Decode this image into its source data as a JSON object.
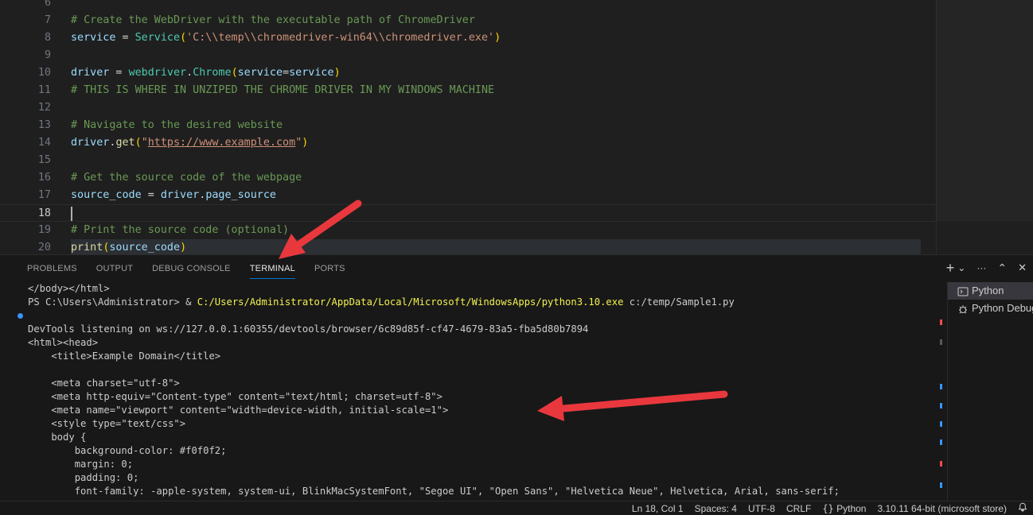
{
  "editor": {
    "lines": [
      {
        "n": "6",
        "tokens": []
      },
      {
        "n": "7",
        "tokens": [
          {
            "c": "c-comment",
            "t": "# Create the WebDriver with the executable path of ChromeDriver"
          }
        ]
      },
      {
        "n": "8",
        "tokens": [
          {
            "c": "c-var",
            "t": "service"
          },
          {
            "c": "c-punc",
            "t": " = "
          },
          {
            "c": "c-cls",
            "t": "Service"
          },
          {
            "c": "c-paren",
            "t": "("
          },
          {
            "c": "c-str",
            "t": "'C:\\\\temp\\\\chromedriver-win64\\\\chromedriver.exe'"
          },
          {
            "c": "c-paren",
            "t": ")"
          }
        ]
      },
      {
        "n": "9",
        "tokens": []
      },
      {
        "n": "10",
        "tokens": [
          {
            "c": "c-var",
            "t": "driver"
          },
          {
            "c": "c-punc",
            "t": " = "
          },
          {
            "c": "c-cls",
            "t": "webdriver"
          },
          {
            "c": "c-punc",
            "t": "."
          },
          {
            "c": "c-cls",
            "t": "Chrome"
          },
          {
            "c": "c-paren",
            "t": "("
          },
          {
            "c": "c-var",
            "t": "service"
          },
          {
            "c": "c-punc",
            "t": "="
          },
          {
            "c": "c-var",
            "t": "service"
          },
          {
            "c": "c-paren",
            "t": ")"
          }
        ]
      },
      {
        "n": "11",
        "tokens": [
          {
            "c": "c-comment",
            "t": "# THIS IS WHERE IN UNZIPED THE CHROME DRIVER IN MY WINDOWS MACHINE"
          }
        ]
      },
      {
        "n": "12",
        "tokens": []
      },
      {
        "n": "13",
        "tokens": [
          {
            "c": "c-comment",
            "t": "# Navigate to the desired website"
          }
        ]
      },
      {
        "n": "14",
        "tokens": [
          {
            "c": "c-var",
            "t": "driver"
          },
          {
            "c": "c-punc",
            "t": "."
          },
          {
            "c": "c-fn",
            "t": "get"
          },
          {
            "c": "c-paren",
            "t": "("
          },
          {
            "c": "c-str",
            "t": "\""
          },
          {
            "c": "c-link",
            "t": "https://www.example.com"
          },
          {
            "c": "c-str",
            "t": "\""
          },
          {
            "c": "c-paren",
            "t": ")"
          }
        ]
      },
      {
        "n": "15",
        "tokens": []
      },
      {
        "n": "16",
        "tokens": [
          {
            "c": "c-comment",
            "t": "# Get the source code of the webpage"
          }
        ]
      },
      {
        "n": "17",
        "tokens": [
          {
            "c": "c-var",
            "t": "source_code"
          },
          {
            "c": "c-punc",
            "t": " = "
          },
          {
            "c": "c-var",
            "t": "driver"
          },
          {
            "c": "c-punc",
            "t": "."
          },
          {
            "c": "c-var",
            "t": "page_source"
          }
        ]
      },
      {
        "n": "18",
        "tokens": [],
        "current": true
      },
      {
        "n": "19",
        "tokens": [
          {
            "c": "c-comment",
            "t": "# Print the source code (optional)"
          }
        ]
      },
      {
        "n": "20",
        "tokens": [
          {
            "c": "c-fn",
            "t": "print"
          },
          {
            "c": "c-paren",
            "t": "("
          },
          {
            "c": "c-var",
            "t": "source_code"
          },
          {
            "c": "c-paren",
            "t": ")"
          }
        ],
        "hl": true
      }
    ]
  },
  "panel": {
    "tabs": [
      {
        "id": "problems",
        "label": "PROBLEMS"
      },
      {
        "id": "output",
        "label": "OUTPUT"
      },
      {
        "id": "debug-console",
        "label": "DEBUG CONSOLE"
      },
      {
        "id": "terminal",
        "label": "TERMINAL",
        "active": true
      },
      {
        "id": "ports",
        "label": "PORTS"
      }
    ],
    "actions": {
      "new_terminal": "+",
      "dropdown": "⌄",
      "more": "···",
      "maximize": "⌃",
      "close": "✕"
    }
  },
  "terminal": {
    "lines": [
      {
        "parts": [
          {
            "t": "</body></html>"
          }
        ]
      },
      {
        "parts": [
          {
            "t": "PS C:\\Users\\Administrator> & "
          },
          {
            "t": "C:/Users/Administrator/AppData/Local/Microsoft/WindowsApps/python3.10.exe",
            "path": true
          },
          {
            "t": " c:/temp/Sample1.py"
          }
        ]
      },
      {
        "parts": [],
        "dot": true
      },
      {
        "parts": [
          {
            "t": "DevTools listening on ws://127.0.0.1:60355/devtools/browser/6c89d85f-cf47-4679-83a5-fba5d80b7894"
          }
        ]
      },
      {
        "parts": [
          {
            "t": "<html><head>"
          }
        ]
      },
      {
        "parts": [
          {
            "t": "    <title>Example Domain</title>"
          }
        ]
      },
      {
        "parts": []
      },
      {
        "parts": [
          {
            "t": "    <meta charset=\"utf-8\">"
          }
        ]
      },
      {
        "parts": [
          {
            "t": "    <meta http-equiv=\"Content-type\" content=\"text/html; charset=utf-8\">"
          }
        ]
      },
      {
        "parts": [
          {
            "t": "    <meta name=\"viewport\" content=\"width=device-width, initial-scale=1\">"
          }
        ]
      },
      {
        "parts": [
          {
            "t": "    <style type=\"text/css\">"
          }
        ]
      },
      {
        "parts": [
          {
            "t": "    body {"
          }
        ]
      },
      {
        "parts": [
          {
            "t": "        background-color: #f0f0f2;"
          }
        ]
      },
      {
        "parts": [
          {
            "t": "        margin: 0;"
          }
        ]
      },
      {
        "parts": [
          {
            "t": "        padding: 0;"
          }
        ]
      },
      {
        "parts": [
          {
            "t": "        font-family: -apple-system, system-ui, BlinkMacSystemFont, \"Segoe UI\", \"Open Sans\", \"Helvetica Neue\", Helvetica, Arial, sans-serif;"
          }
        ]
      }
    ],
    "instances": [
      {
        "label": "Python",
        "icon": "terminal-icon",
        "active": true
      },
      {
        "label": "Python Debug Console",
        "icon": "debug-icon"
      }
    ]
  },
  "statusbar": {
    "position": "Ln 18, Col 1",
    "spaces": "Spaces: 4",
    "encoding": "UTF-8",
    "eol": "CRLF",
    "language": "Python",
    "interpreter": "3.10.11 64-bit (microsoft store)"
  },
  "colors": {
    "accent": "#0078d4",
    "annotation_arrow": "#e8383d"
  }
}
